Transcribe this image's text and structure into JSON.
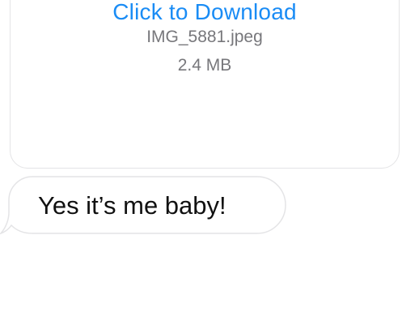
{
  "attachment": {
    "action_label": "Click to Download",
    "file_name": "IMG_5881.jpeg",
    "file_size": "2.4 MB"
  },
  "message": {
    "text": "Yes it’s me baby!"
  },
  "colors": {
    "link_blue": "#1a8cf5",
    "meta_gray": "#77777b",
    "bubble_border": "#e4e4e6",
    "text_dark": "#111111"
  }
}
